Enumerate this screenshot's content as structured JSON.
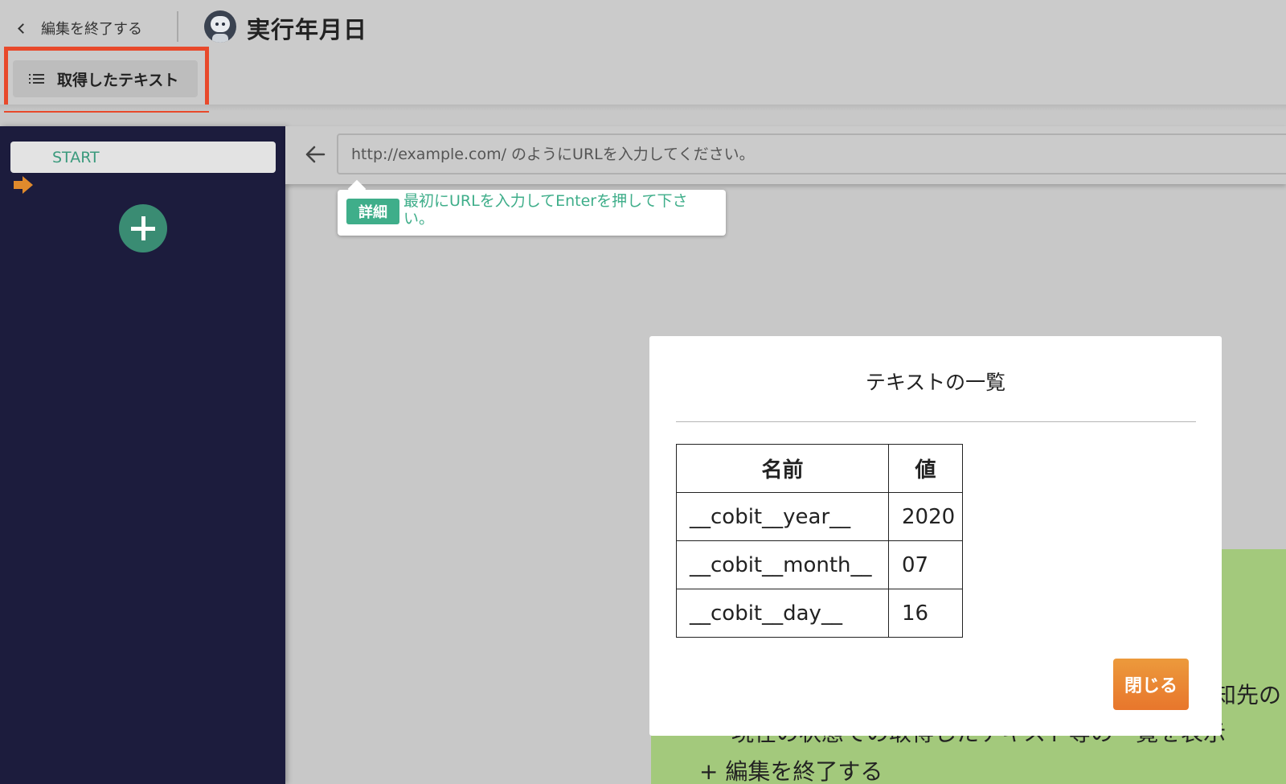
{
  "header": {
    "back_label": "編集を終了する",
    "title": "実行年月日",
    "extracted_text_button": "取得したテキスト"
  },
  "sidebar": {
    "start_label": "START"
  },
  "browser": {
    "url_placeholder": "http://example.com/ のようにURLを入力してください。",
    "tooltip_badge": "詳細",
    "tooltip_text": "最初にURLを入力してEnterを押して下さい。"
  },
  "modal": {
    "title": "テキストの一覧",
    "columns": [
      "名前",
      "値"
    ],
    "rows": [
      [
        "__cobit__year__",
        "2020"
      ],
      [
        "__cobit__month__",
        "07"
      ],
      [
        "__cobit__day__",
        "16"
      ]
    ],
    "close_label": "閉じる"
  },
  "background_panel": {
    "lines": [
      "知先の",
      "現在の状態での取得したテキスト等の一覧を表示",
      "+ 編集を終了する"
    ]
  },
  "colors": {
    "sidebar_bg": "#1c1c3d",
    "accent_green": "#3fae8a",
    "highlight_red": "#e8492b",
    "close_button_orange": "#e8762c",
    "panel_green": "#a3c97c"
  }
}
